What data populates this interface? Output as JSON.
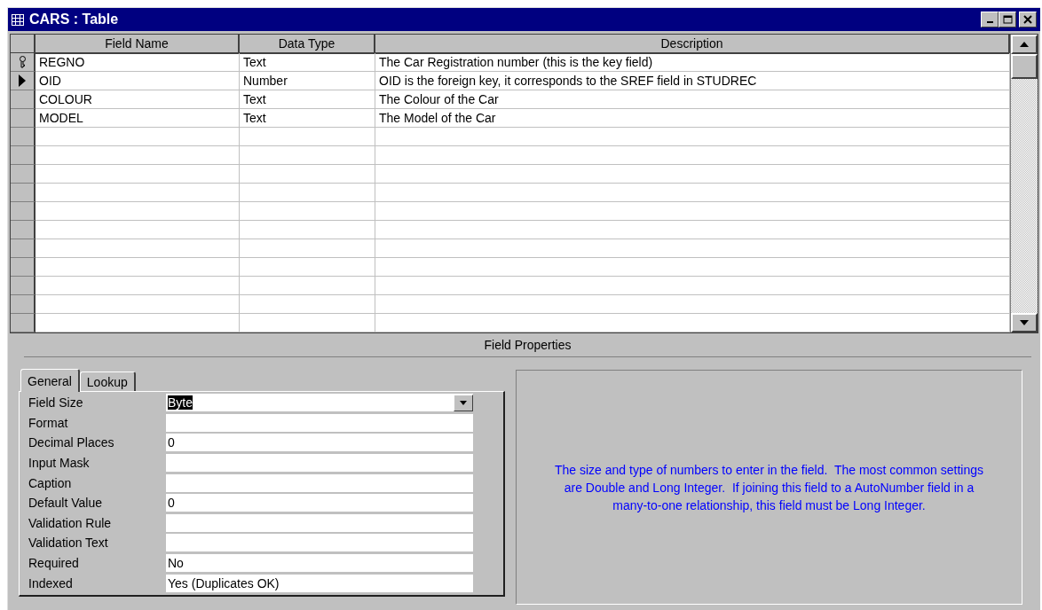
{
  "window": {
    "title": "CARS : Table"
  },
  "table": {
    "columns": [
      "Field Name",
      "Data Type",
      "Description"
    ],
    "rows": [
      {
        "field_name": "REGNO",
        "data_type": "Text",
        "description": "The Car Registration number (this is the key field)",
        "primary_key": true,
        "selected": false
      },
      {
        "field_name": "OID",
        "data_type": "Number",
        "description": "OID is the foreign key, it corresponds to the SREF field in STUDREC",
        "primary_key": false,
        "selected": true
      },
      {
        "field_name": "COLOUR",
        "data_type": "Text",
        "description": "The Colour of the Car",
        "primary_key": false,
        "selected": false
      },
      {
        "field_name": "MODEL",
        "data_type": "Text",
        "description": "The Model of the Car",
        "primary_key": false,
        "selected": false
      }
    ]
  },
  "field_properties": {
    "title": "Field Properties",
    "tabs": [
      {
        "label": "General",
        "selected": true
      },
      {
        "label": "Lookup",
        "selected": false
      }
    ],
    "properties": [
      {
        "label": "Field Size",
        "value": "Byte",
        "kind": "dropdown",
        "highlighted": true
      },
      {
        "label": "Format",
        "kind": "text"
      },
      {
        "label": "Decimal Places",
        "value": "0",
        "kind": "text"
      },
      {
        "label": "Input Mask",
        "kind": "text"
      },
      {
        "label": "Caption",
        "kind": "text"
      },
      {
        "label": "Default Value",
        "value": "0",
        "kind": "text"
      },
      {
        "label": "Validation Rule",
        "kind": "text"
      },
      {
        "label": "Validation Text",
        "kind": "text"
      },
      {
        "label": "Required",
        "value": "No",
        "kind": "text"
      },
      {
        "label": "Indexed",
        "value": "Yes (Duplicates OK)",
        "kind": "text"
      }
    ],
    "help_text": "The size and type of numbers to enter in the field.  The most common settings are Double and Long Integer.  If joining this field to a AutoNumber field in a many-to-one relationship, this field must be Long Integer."
  }
}
